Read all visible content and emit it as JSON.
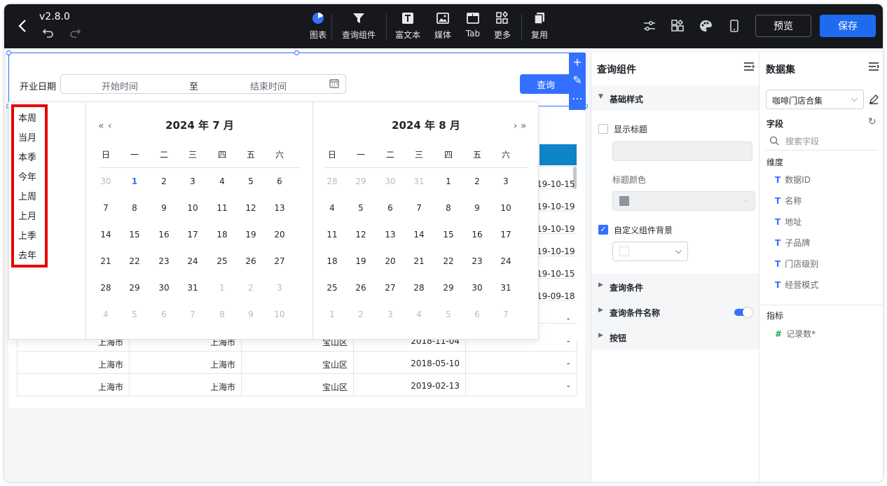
{
  "header": {
    "version": "v2.8.0",
    "tools": [
      {
        "label": "图表",
        "icon": "chart-pie-icon"
      },
      {
        "label": "查询组件",
        "icon": "filter-funnel-icon"
      },
      {
        "label": "富文本",
        "icon": "rich-text-icon"
      },
      {
        "label": "媒体",
        "icon": "image-icon"
      },
      {
        "label": "Tab",
        "icon": "tab-icon"
      },
      {
        "label": "更多",
        "icon": "more-grid-icon"
      },
      {
        "label": "复用",
        "icon": "copy-icon"
      }
    ],
    "preview_label": "预览",
    "save_label": "保存"
  },
  "query": {
    "date_label": "开业日期",
    "start_placeholder": "开始时间",
    "to_label": "至",
    "end_placeholder": "结束时间",
    "query_button": "查询"
  },
  "table": {
    "dates_partial": [
      "19-10-15",
      "19-10-19",
      "19-10-19",
      "19-10-19",
      "19-10-15",
      "19-09-18"
    ],
    "dash_rows": [
      "-",
      "-",
      "-",
      "-",
      "-",
      "-"
    ],
    "rows": [
      {
        "city": "上海市",
        "city2": "上海市",
        "district": "宝山区",
        "date": "2018-11-04",
        "extra": "-"
      },
      {
        "city": "上海市",
        "city2": "上海市",
        "district": "宝山区",
        "date": "2018-05-10",
        "extra": "-"
      },
      {
        "city": "上海市",
        "city2": "上海市",
        "district": "宝山区",
        "date": "2019-02-13",
        "extra": "-"
      }
    ]
  },
  "picker": {
    "shortcuts": [
      "本周",
      "当月",
      "本季",
      "今年",
      "上周",
      "上月",
      "上季",
      "去年"
    ],
    "weekdays": [
      "日",
      "一",
      "二",
      "三",
      "四",
      "五",
      "六"
    ],
    "left": {
      "title": "2024 年 7 月",
      "weeks": [
        [
          "30",
          "1",
          "2",
          "3",
          "4",
          "5",
          "6"
        ],
        [
          "7",
          "8",
          "9",
          "10",
          "11",
          "12",
          "13"
        ],
        [
          "14",
          "15",
          "16",
          "17",
          "18",
          "19",
          "20"
        ],
        [
          "21",
          "22",
          "23",
          "24",
          "25",
          "26",
          "27"
        ],
        [
          "28",
          "29",
          "30",
          "31",
          "1",
          "2",
          "3"
        ],
        [
          "4",
          "5",
          "6",
          "7",
          "8",
          "9",
          "10"
        ]
      ]
    },
    "right": {
      "title": "2024 年 8 月",
      "weeks": [
        [
          "28",
          "29",
          "30",
          "31",
          "1",
          "2",
          "3"
        ],
        [
          "4",
          "5",
          "6",
          "7",
          "8",
          "9",
          "10"
        ],
        [
          "11",
          "12",
          "13",
          "14",
          "15",
          "16",
          "17"
        ],
        [
          "18",
          "19",
          "20",
          "21",
          "22",
          "23",
          "24"
        ],
        [
          "25",
          "26",
          "27",
          "28",
          "29",
          "30",
          "31"
        ],
        [
          "1",
          "2",
          "3",
          "4",
          "5",
          "6",
          "7"
        ]
      ]
    }
  },
  "query_panel": {
    "title": "查询组件",
    "basic_style": "基础样式",
    "show_title": "显示标题",
    "title_color": "标题颜色",
    "custom_bg": "自定义组件背景",
    "sections": [
      "查询条件",
      "查询条件名称",
      "按钮"
    ]
  },
  "dataset_panel": {
    "title": "数据集",
    "dataset": "咖啡门店合集",
    "fields_label": "字段",
    "search_placeholder": "搜索字段",
    "dimension_label": "维度",
    "dimensions": [
      "数据ID",
      "名称",
      "地址",
      "子品牌",
      "门店级别",
      "经营模式"
    ],
    "metric_label": "指标",
    "metrics": [
      "记录数*"
    ]
  },
  "colors": {
    "accent": "#3370ff",
    "topbar": "#16181d",
    "highlight": "#e60000"
  }
}
